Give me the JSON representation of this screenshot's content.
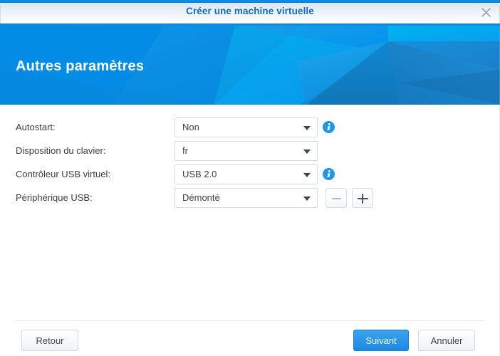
{
  "window": {
    "title": "Créer une machine virtuelle",
    "close_icon": "close-icon",
    "accent_color": "#0b8ae2",
    "title_color": "#1668c4"
  },
  "banner": {
    "heading": "Autres paramètres",
    "background_color": "#038ce6"
  },
  "form": {
    "rows": [
      {
        "label": "Autostart:",
        "value": "Non",
        "control": "dropdown",
        "has_info_icon": true,
        "info_icon": "info-icon"
      },
      {
        "label": "Disposition du clavier:",
        "value": "fr",
        "control": "dropdown",
        "has_info_icon": false
      },
      {
        "label": "Contrôleur USB virtuel:",
        "value": "USB 2.0",
        "control": "dropdown",
        "has_info_icon": true,
        "info_icon": "info-icon"
      },
      {
        "label": "Périphérique USB:",
        "value": "Démonté",
        "control": "dropdown",
        "has_info_icon": false,
        "stepper": {
          "minus_label": "−",
          "plus_label": "+",
          "minus_icon": "minus-icon",
          "plus_icon": "plus-icon"
        }
      }
    ]
  },
  "footer": {
    "back_label": "Retour",
    "next_label": "Suivant",
    "cancel_label": "Annuler",
    "primary_color": "#1b8ae4"
  }
}
